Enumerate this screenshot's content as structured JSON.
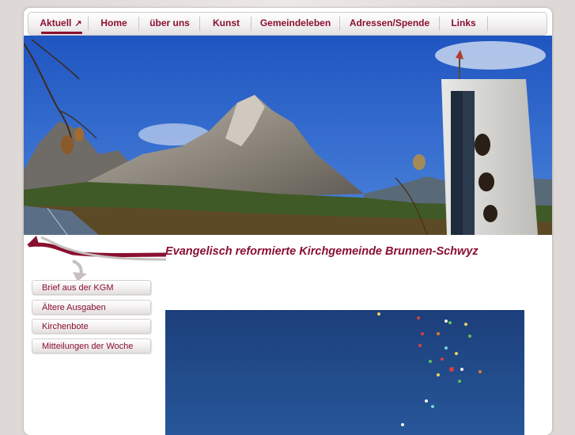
{
  "nav": {
    "items": [
      {
        "label": "Aktuell",
        "active": true
      },
      {
        "label": "Home"
      },
      {
        "label": "über uns"
      },
      {
        "label": "Kunst"
      },
      {
        "label": "Gemeindeleben"
      },
      {
        "label": "Adressen/Spende"
      },
      {
        "label": "Links"
      }
    ],
    "active_icon": "external-arrow-icon"
  },
  "header": {
    "title": "Evangelisch reformierte Kirchgemeinde Brunnen-Schwyz"
  },
  "sidebar": {
    "items": [
      {
        "label": "Brief aus der KGM"
      },
      {
        "label": "Ältere Ausgaben"
      },
      {
        "label": "Kirchenbote"
      },
      {
        "label": "Mitteilungen der Woche"
      }
    ]
  },
  "colors": {
    "accent": "#8a1030",
    "sky": "#2d63c8",
    "balloon_sky": "#1f4a86"
  }
}
